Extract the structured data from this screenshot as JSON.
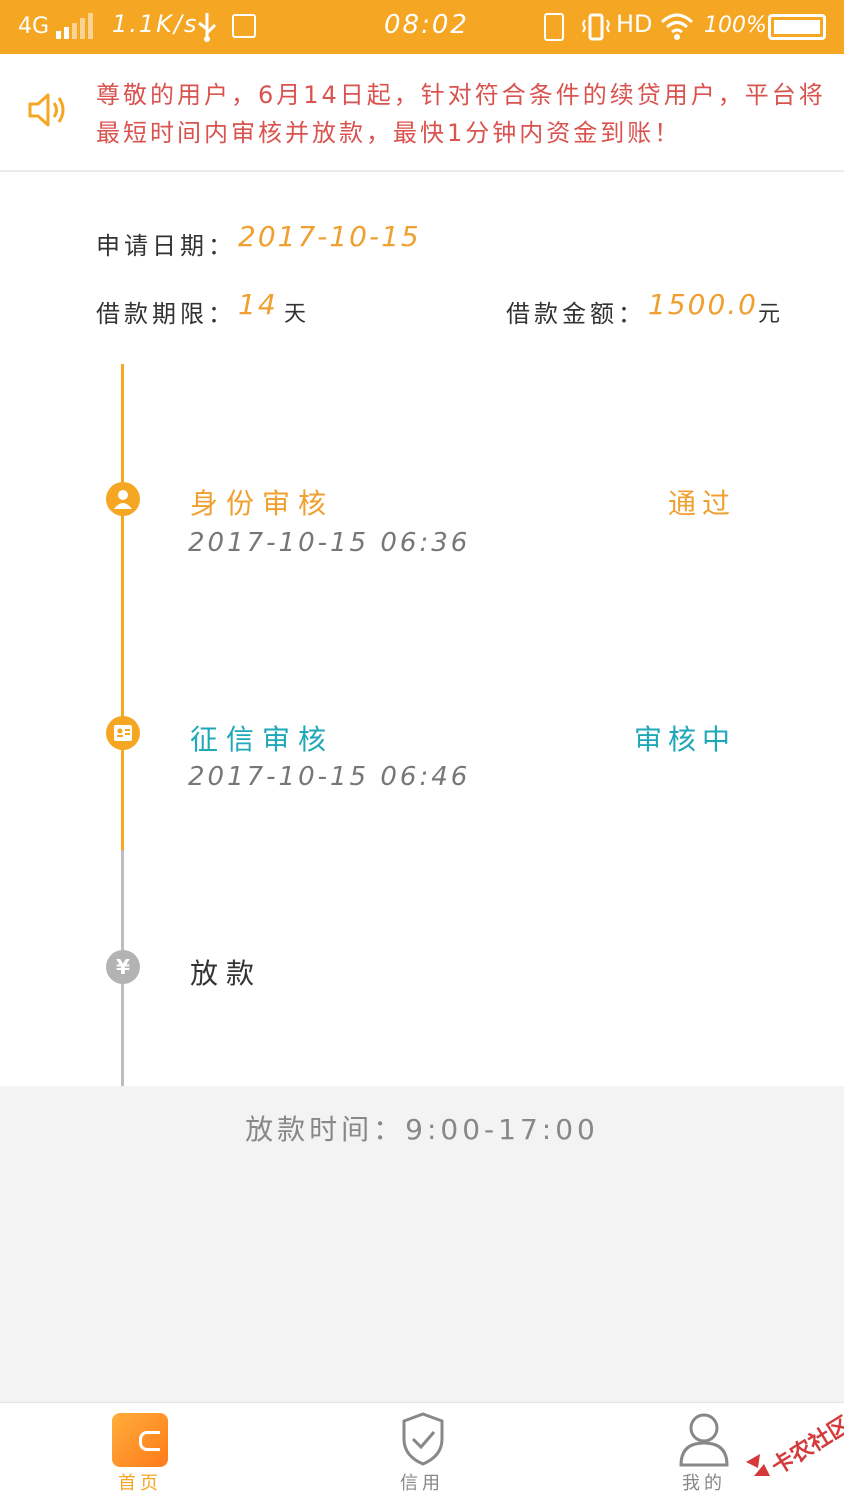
{
  "status_bar": {
    "network": "4G",
    "speed": "1.1K/s",
    "time": "08:02",
    "hd": "HD",
    "battery": "100%"
  },
  "notice": {
    "icon": "speaker-icon",
    "text": "尊敬的用户，6月14日起，针对符合条件的续贷用户，平台将最短时间内审核并放款，最快1分钟内资金到账！"
  },
  "info": {
    "apply_date_label": "申请日期：",
    "apply_date": "2017-10-15",
    "term_label": "借款期限：",
    "term_value": "14",
    "term_unit": "天",
    "amount_label": "借款金额：",
    "amount_value": "1500.0",
    "amount_unit": "元"
  },
  "timeline": {
    "steps": [
      {
        "title": "身份审核",
        "time": "2017-10-15 06:36",
        "status": "通过",
        "icon": "user-icon"
      },
      {
        "title": "征信审核",
        "time": "2017-10-15 06:46",
        "status": "审核中",
        "icon": "id-card-icon"
      },
      {
        "title": "放款",
        "icon": "yen-icon",
        "icon_glyph": "¥"
      }
    ]
  },
  "loan_time": "放款时间：9:00-17:00",
  "nav": {
    "items": [
      {
        "label": "首页",
        "icon": "wallet-icon",
        "active": true
      },
      {
        "label": "信用",
        "icon": "shield-check-icon",
        "active": false
      },
      {
        "label": "我的",
        "icon": "person-icon",
        "active": false
      }
    ]
  },
  "watermark": "卡农社区",
  "colors": {
    "accent": "#f5a623",
    "notice_text": "#d9534f",
    "teal": "#1fa8b8",
    "gray_node": "#b3b3b3"
  }
}
